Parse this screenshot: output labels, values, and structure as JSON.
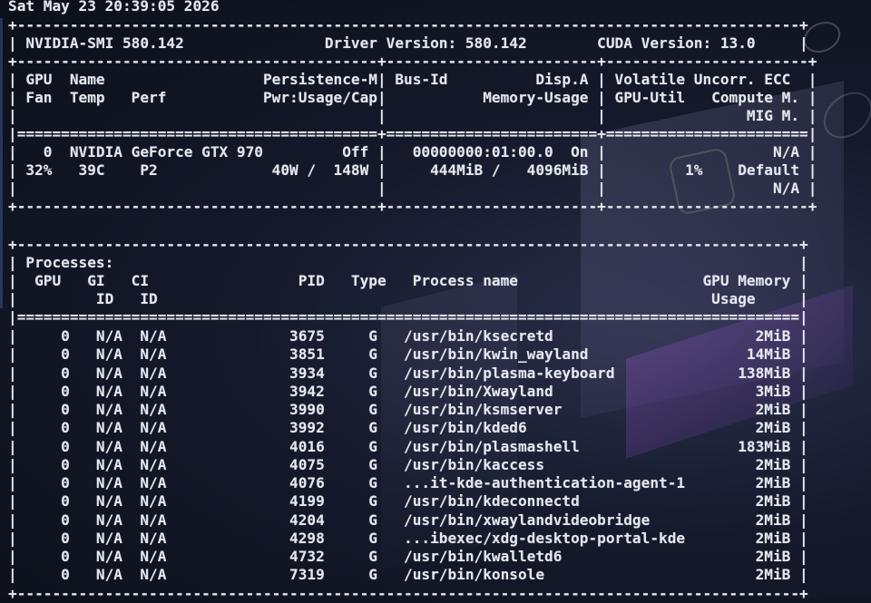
{
  "timestamp": "Sat May 23 20:39:05 2026",
  "header": {
    "smi_label": "NVIDIA-SMI",
    "smi_version": "580.142",
    "driver_label": "Driver Version:",
    "driver_version": "580.142",
    "cuda_label": "CUDA Version:",
    "cuda_version": "13.0"
  },
  "gpu_columns": {
    "row1": {
      "gpu": "GPU",
      "name": "Name",
      "persistence": "Persistence-M",
      "bus": "Bus-Id",
      "disp": "Disp.A",
      "volatile": "Volatile Uncorr. ECC"
    },
    "row2": {
      "fan": "Fan",
      "temp": "Temp",
      "perf": "Perf",
      "pwr": "Pwr:Usage/Cap",
      "memory": "Memory-Usage",
      "util": "GPU-Util",
      "compute": "Compute M."
    },
    "row3": {
      "mig": "MIG M."
    }
  },
  "gpu": {
    "index": "0",
    "name": "NVIDIA GeForce GTX 970",
    "persistence": "Off",
    "bus_id": "00000000:01:00.0",
    "disp": "On",
    "ecc": "N/A",
    "fan": "32%",
    "temp": "39C",
    "perf": "P2",
    "pwr_usage": "40W",
    "pwr_cap": "148W",
    "mem_used": "444MiB",
    "mem_total": "4096MiB",
    "util": "1%",
    "compute_mode": "Default",
    "mig_mode": "N/A"
  },
  "processes": {
    "title": "Processes:",
    "columns": {
      "gpu": "GPU",
      "gi": "GI",
      "gi2": "ID",
      "ci": "CI",
      "ci2": "ID",
      "pid": "PID",
      "type": "Type",
      "name": "Process name",
      "mem": "GPU Memory",
      "mem2": "Usage"
    },
    "rows": [
      {
        "gpu": "0",
        "gi": "N/A",
        "ci": "N/A",
        "pid": "3675",
        "type": "G",
        "name": "/usr/bin/ksecretd",
        "mem": "2MiB"
      },
      {
        "gpu": "0",
        "gi": "N/A",
        "ci": "N/A",
        "pid": "3851",
        "type": "G",
        "name": "/usr/bin/kwin_wayland",
        "mem": "14MiB"
      },
      {
        "gpu": "0",
        "gi": "N/A",
        "ci": "N/A",
        "pid": "3934",
        "type": "G",
        "name": "/usr/bin/plasma-keyboard",
        "mem": "138MiB"
      },
      {
        "gpu": "0",
        "gi": "N/A",
        "ci": "N/A",
        "pid": "3942",
        "type": "G",
        "name": "/usr/bin/Xwayland",
        "mem": "3MiB"
      },
      {
        "gpu": "0",
        "gi": "N/A",
        "ci": "N/A",
        "pid": "3990",
        "type": "G",
        "name": "/usr/bin/ksmserver",
        "mem": "2MiB"
      },
      {
        "gpu": "0",
        "gi": "N/A",
        "ci": "N/A",
        "pid": "3992",
        "type": "G",
        "name": "/usr/bin/kded6",
        "mem": "2MiB"
      },
      {
        "gpu": "0",
        "gi": "N/A",
        "ci": "N/A",
        "pid": "4016",
        "type": "G",
        "name": "/usr/bin/plasmashell",
        "mem": "183MiB"
      },
      {
        "gpu": "0",
        "gi": "N/A",
        "ci": "N/A",
        "pid": "4075",
        "type": "G",
        "name": "/usr/bin/kaccess",
        "mem": "2MiB"
      },
      {
        "gpu": "0",
        "gi": "N/A",
        "ci": "N/A",
        "pid": "4076",
        "type": "G",
        "name": "...it-kde-authentication-agent-1",
        "mem": "2MiB"
      },
      {
        "gpu": "0",
        "gi": "N/A",
        "ci": "N/A",
        "pid": "4199",
        "type": "G",
        "name": "/usr/bin/kdeconnectd",
        "mem": "2MiB"
      },
      {
        "gpu": "0",
        "gi": "N/A",
        "ci": "N/A",
        "pid": "4204",
        "type": "G",
        "name": "/usr/bin/xwaylandvideobridge",
        "mem": "2MiB"
      },
      {
        "gpu": "0",
        "gi": "N/A",
        "ci": "N/A",
        "pid": "4298",
        "type": "G",
        "name": "...ibexec/xdg-desktop-portal-kde",
        "mem": "2MiB"
      },
      {
        "gpu": "0",
        "gi": "N/A",
        "ci": "N/A",
        "pid": "4732",
        "type": "G",
        "name": "/usr/bin/kwalletd6",
        "mem": "2MiB"
      },
      {
        "gpu": "0",
        "gi": "N/A",
        "ci": "N/A",
        "pid": "7319",
        "type": "G",
        "name": "/usr/bin/konsole",
        "mem": "2MiB"
      }
    ]
  }
}
